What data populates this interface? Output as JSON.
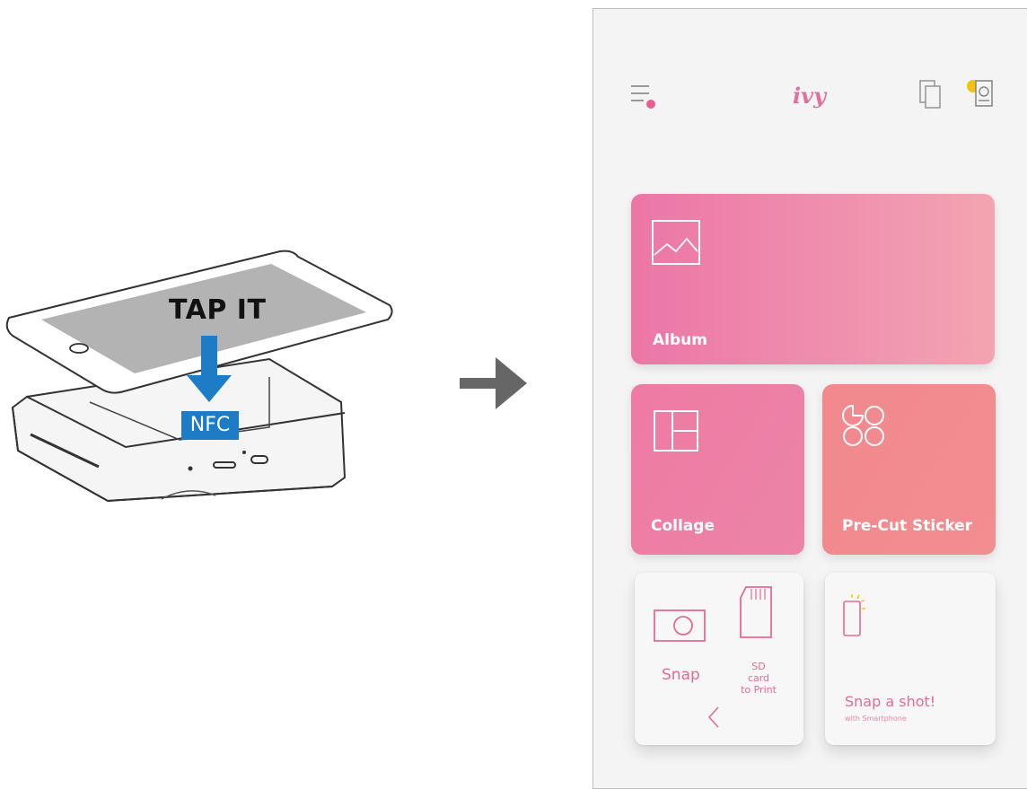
{
  "illustration": {
    "tap_label": "TAP IT",
    "nfc_label": "NFC"
  },
  "app": {
    "logo": "ivy",
    "icons": [
      "menu-icon",
      "copies-icon",
      "printer-status-icon"
    ],
    "cards": {
      "album": {
        "label": "Album",
        "icon": "image-icon"
      },
      "collage": {
        "label": "Collage",
        "icon": "collage-icon"
      },
      "sticker": {
        "label": "Pre-Cut Sticker",
        "icon": "sticker-icon"
      },
      "snap": {
        "label": "Snap",
        "icon": "camera-icon"
      },
      "sdcard": {
        "label_line1": "SD card",
        "label_line2": "to Print",
        "icon": "sd-card-icon"
      },
      "snapshot": {
        "label": "Snap a shot!",
        "sublabel": "with Smartphone",
        "icon": "smartphone-icon"
      }
    },
    "colors": {
      "accent": "#e36f9e",
      "album": "#ec76a6",
      "collage": "#ef7aa3",
      "sticker": "#f1898f",
      "nfc": "#1e7bc6"
    }
  }
}
